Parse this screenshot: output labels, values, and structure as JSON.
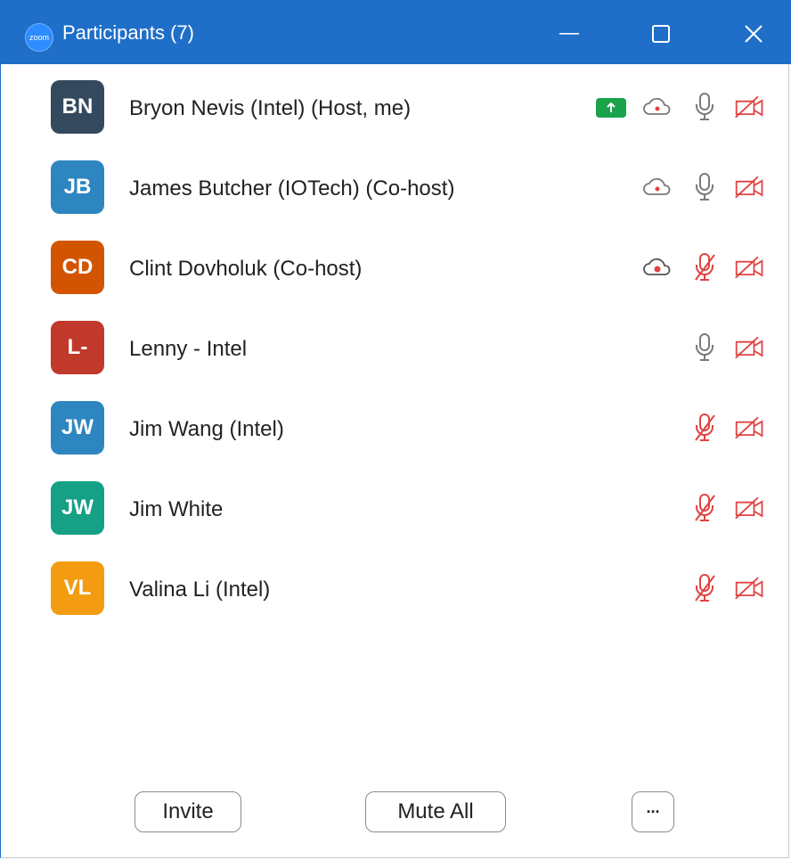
{
  "window": {
    "title": "Participants (7)",
    "logo_text": "zoom"
  },
  "participants": [
    {
      "initials": "BN",
      "name": "Bryon Nevis (Intel) (Host, me)",
      "avatar_color": "#34495e",
      "sharing": true,
      "recording": true,
      "mic": "on",
      "video": "off"
    },
    {
      "initials": "JB",
      "name": "James Butcher (IOTech) (Co-host)",
      "avatar_color": "#2e86c1",
      "sharing": false,
      "recording": true,
      "mic": "on",
      "video": "off"
    },
    {
      "initials": "CD",
      "name": "Clint Dovholuk (Co-host)",
      "avatar_color": "#d35400",
      "sharing": false,
      "recording": true,
      "recording_active": true,
      "mic": "muted",
      "video": "off"
    },
    {
      "initials": "L-",
      "name": "Lenny - Intel",
      "avatar_color": "#c0392b",
      "sharing": false,
      "recording": false,
      "mic": "on",
      "video": "off"
    },
    {
      "initials": "JW",
      "name": "Jim Wang (Intel)",
      "avatar_color": "#2e86c1",
      "sharing": false,
      "recording": false,
      "mic": "muted",
      "video": "off"
    },
    {
      "initials": "JW",
      "name": "Jim White",
      "avatar_color": "#16a085",
      "sharing": false,
      "recording": false,
      "mic": "muted",
      "video": "off"
    },
    {
      "initials": "VL",
      "name": "Valina Li (Intel)",
      "avatar_color": "#f39c12",
      "sharing": false,
      "recording": false,
      "mic": "muted",
      "video": "off"
    }
  ],
  "footer": {
    "invite_label": "Invite",
    "mute_all_label": "Mute All",
    "more_label": "···"
  },
  "colors": {
    "titlebar": "#1f6fc9",
    "muted_red": "#e04343",
    "icon_gray": "#7a7a7a",
    "share_green": "#1aa34a"
  }
}
